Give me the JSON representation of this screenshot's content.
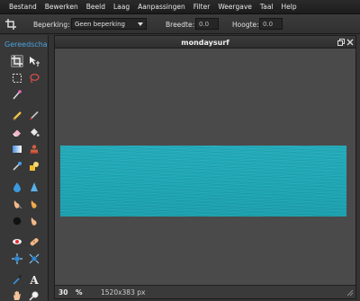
{
  "menu": [
    "Bestand",
    "Bewerken",
    "Beeld",
    "Laag",
    "Aanpassingen",
    "Filter",
    "Weergave",
    "Taal",
    "Help"
  ],
  "options": {
    "restriction_label": "Beperking:",
    "restriction_value": "Geen beperking",
    "width_label": "Breedte:",
    "width_value": "0.0",
    "height_label": "Hoogte:",
    "height_value": "0.0"
  },
  "toolbox": {
    "title": "Gereedscha",
    "tools": [
      "crop-icon",
      "move-icon",
      "marquee-icon",
      "lasso-icon",
      "magic-wand-icon",
      "pencil-icon",
      "brush-icon",
      "eraser-icon",
      "paint-bucket-icon",
      "gradient-icon",
      "clone-stamp-icon",
      "color-replace-icon",
      "shapes-icon",
      "blur-icon",
      "sharpen-icon",
      "smudge-icon",
      "sponge-icon",
      "dodge-icon",
      "burn-icon",
      "red-eye-icon",
      "spot-heal-icon",
      "bloat-icon",
      "pinch-icon",
      "eyedropper-icon",
      "text-icon",
      "hand-icon",
      "zoom-icon"
    ]
  },
  "document": {
    "title": "mondaysurf",
    "zoom": "30",
    "zoom_unit": "%",
    "dimensions": "1520x383 px"
  },
  "colors": {
    "accent": "#4aa3e0",
    "water": "#1ea7b6"
  }
}
